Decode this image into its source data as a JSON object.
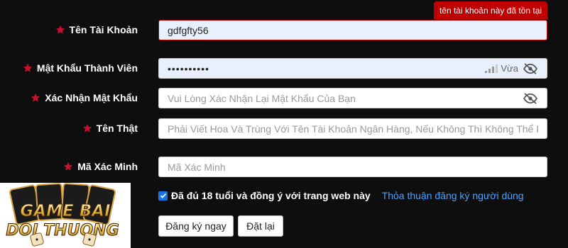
{
  "error_tooltip": "tên tài khoản này đã tồn tại",
  "fields": {
    "username": {
      "label": "Tên Tài Khoản",
      "value": "gdfgfty56"
    },
    "password": {
      "label": "Mật Khẩu Thành Viên",
      "value": "••••••••••",
      "strength": "Vừa"
    },
    "confirm": {
      "label": "Xác Nhận Mật Khẩu",
      "placeholder": "Vui Lòng Xác Nhận Lại Mật Khẩu Của Bạn"
    },
    "realname": {
      "label": "Tên Thật",
      "placeholder": "Phải Viết Hoa Và Trùng Với Tên Tài Khoản Ngân Hàng, Nếu Không Thì Không Thể Rút"
    },
    "code": {
      "label": "Mã Xác Minh",
      "placeholder": "Mã Xác Minh"
    }
  },
  "agree": {
    "checked": true,
    "text": "Đã đủ 18 tuổi và đồng ý với trang web này",
    "link": "Thỏa thuận đăng ký người dùng"
  },
  "buttons": {
    "register": "Đăng ký ngay",
    "reset": "Đặt lại"
  },
  "logo": {
    "line1": "GAME BAI",
    "line2": "DOI THUONG"
  },
  "colors": {
    "star": "#c8102e",
    "error": "#c00000",
    "link": "#4aa3ff",
    "checkbox": "#1a73e8"
  }
}
